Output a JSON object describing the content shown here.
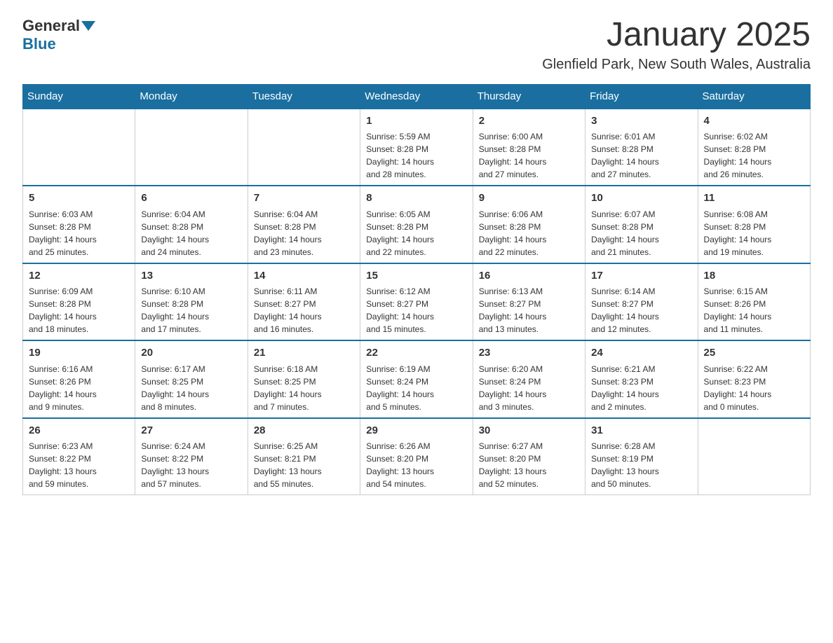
{
  "logo": {
    "general": "General",
    "blue": "Blue"
  },
  "title": "January 2025",
  "location": "Glenfield Park, New South Wales, Australia",
  "days_of_week": [
    "Sunday",
    "Monday",
    "Tuesday",
    "Wednesday",
    "Thursday",
    "Friday",
    "Saturday"
  ],
  "weeks": [
    [
      {
        "day": "",
        "info": ""
      },
      {
        "day": "",
        "info": ""
      },
      {
        "day": "",
        "info": ""
      },
      {
        "day": "1",
        "info": "Sunrise: 5:59 AM\nSunset: 8:28 PM\nDaylight: 14 hours\nand 28 minutes."
      },
      {
        "day": "2",
        "info": "Sunrise: 6:00 AM\nSunset: 8:28 PM\nDaylight: 14 hours\nand 27 minutes."
      },
      {
        "day": "3",
        "info": "Sunrise: 6:01 AM\nSunset: 8:28 PM\nDaylight: 14 hours\nand 27 minutes."
      },
      {
        "day": "4",
        "info": "Sunrise: 6:02 AM\nSunset: 8:28 PM\nDaylight: 14 hours\nand 26 minutes."
      }
    ],
    [
      {
        "day": "5",
        "info": "Sunrise: 6:03 AM\nSunset: 8:28 PM\nDaylight: 14 hours\nand 25 minutes."
      },
      {
        "day": "6",
        "info": "Sunrise: 6:04 AM\nSunset: 8:28 PM\nDaylight: 14 hours\nand 24 minutes."
      },
      {
        "day": "7",
        "info": "Sunrise: 6:04 AM\nSunset: 8:28 PM\nDaylight: 14 hours\nand 23 minutes."
      },
      {
        "day": "8",
        "info": "Sunrise: 6:05 AM\nSunset: 8:28 PM\nDaylight: 14 hours\nand 22 minutes."
      },
      {
        "day": "9",
        "info": "Sunrise: 6:06 AM\nSunset: 8:28 PM\nDaylight: 14 hours\nand 22 minutes."
      },
      {
        "day": "10",
        "info": "Sunrise: 6:07 AM\nSunset: 8:28 PM\nDaylight: 14 hours\nand 21 minutes."
      },
      {
        "day": "11",
        "info": "Sunrise: 6:08 AM\nSunset: 8:28 PM\nDaylight: 14 hours\nand 19 minutes."
      }
    ],
    [
      {
        "day": "12",
        "info": "Sunrise: 6:09 AM\nSunset: 8:28 PM\nDaylight: 14 hours\nand 18 minutes."
      },
      {
        "day": "13",
        "info": "Sunrise: 6:10 AM\nSunset: 8:28 PM\nDaylight: 14 hours\nand 17 minutes."
      },
      {
        "day": "14",
        "info": "Sunrise: 6:11 AM\nSunset: 8:27 PM\nDaylight: 14 hours\nand 16 minutes."
      },
      {
        "day": "15",
        "info": "Sunrise: 6:12 AM\nSunset: 8:27 PM\nDaylight: 14 hours\nand 15 minutes."
      },
      {
        "day": "16",
        "info": "Sunrise: 6:13 AM\nSunset: 8:27 PM\nDaylight: 14 hours\nand 13 minutes."
      },
      {
        "day": "17",
        "info": "Sunrise: 6:14 AM\nSunset: 8:27 PM\nDaylight: 14 hours\nand 12 minutes."
      },
      {
        "day": "18",
        "info": "Sunrise: 6:15 AM\nSunset: 8:26 PM\nDaylight: 14 hours\nand 11 minutes."
      }
    ],
    [
      {
        "day": "19",
        "info": "Sunrise: 6:16 AM\nSunset: 8:26 PM\nDaylight: 14 hours\nand 9 minutes."
      },
      {
        "day": "20",
        "info": "Sunrise: 6:17 AM\nSunset: 8:25 PM\nDaylight: 14 hours\nand 8 minutes."
      },
      {
        "day": "21",
        "info": "Sunrise: 6:18 AM\nSunset: 8:25 PM\nDaylight: 14 hours\nand 7 minutes."
      },
      {
        "day": "22",
        "info": "Sunrise: 6:19 AM\nSunset: 8:24 PM\nDaylight: 14 hours\nand 5 minutes."
      },
      {
        "day": "23",
        "info": "Sunrise: 6:20 AM\nSunset: 8:24 PM\nDaylight: 14 hours\nand 3 minutes."
      },
      {
        "day": "24",
        "info": "Sunrise: 6:21 AM\nSunset: 8:23 PM\nDaylight: 14 hours\nand 2 minutes."
      },
      {
        "day": "25",
        "info": "Sunrise: 6:22 AM\nSunset: 8:23 PM\nDaylight: 14 hours\nand 0 minutes."
      }
    ],
    [
      {
        "day": "26",
        "info": "Sunrise: 6:23 AM\nSunset: 8:22 PM\nDaylight: 13 hours\nand 59 minutes."
      },
      {
        "day": "27",
        "info": "Sunrise: 6:24 AM\nSunset: 8:22 PM\nDaylight: 13 hours\nand 57 minutes."
      },
      {
        "day": "28",
        "info": "Sunrise: 6:25 AM\nSunset: 8:21 PM\nDaylight: 13 hours\nand 55 minutes."
      },
      {
        "day": "29",
        "info": "Sunrise: 6:26 AM\nSunset: 8:20 PM\nDaylight: 13 hours\nand 54 minutes."
      },
      {
        "day": "30",
        "info": "Sunrise: 6:27 AM\nSunset: 8:20 PM\nDaylight: 13 hours\nand 52 minutes."
      },
      {
        "day": "31",
        "info": "Sunrise: 6:28 AM\nSunset: 8:19 PM\nDaylight: 13 hours\nand 50 minutes."
      },
      {
        "day": "",
        "info": ""
      }
    ]
  ]
}
